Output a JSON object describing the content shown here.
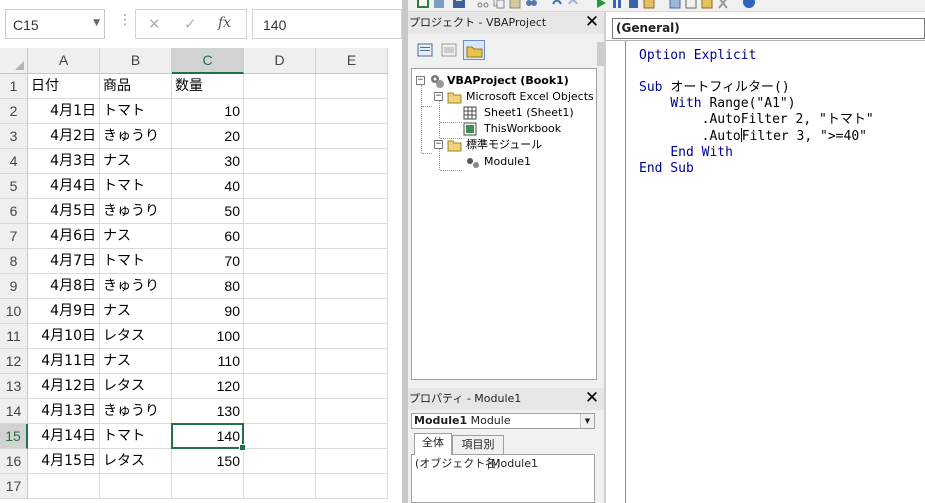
{
  "excel": {
    "name_box": "C15",
    "formula_value": "140",
    "formula_buttons": {
      "cancel": "✕",
      "enter": "✓",
      "fx": "fx"
    },
    "columns": [
      "A",
      "B",
      "C",
      "D",
      "E"
    ],
    "selected_column": "C",
    "selected_row": 15,
    "rows": [
      {
        "n": "1",
        "a": "日付",
        "b": "商品",
        "c": "数量"
      },
      {
        "n": "2",
        "a": "4月1日",
        "b": "トマト",
        "c": "10"
      },
      {
        "n": "3",
        "a": "4月2日",
        "b": "きゅうり",
        "c": "20"
      },
      {
        "n": "4",
        "a": "4月3日",
        "b": "ナス",
        "c": "30"
      },
      {
        "n": "5",
        "a": "4月4日",
        "b": "トマト",
        "c": "40"
      },
      {
        "n": "6",
        "a": "4月5日",
        "b": "きゅうり",
        "c": "50"
      },
      {
        "n": "7",
        "a": "4月6日",
        "b": "ナス",
        "c": "60"
      },
      {
        "n": "8",
        "a": "4月7日",
        "b": "トマト",
        "c": "70"
      },
      {
        "n": "9",
        "a": "4月8日",
        "b": "きゅうり",
        "c": "80"
      },
      {
        "n": "10",
        "a": "4月9日",
        "b": "ナス",
        "c": "90"
      },
      {
        "n": "11",
        "a": "4月10日",
        "b": "レタス",
        "c": "100"
      },
      {
        "n": "12",
        "a": "4月11日",
        "b": "ナス",
        "c": "110"
      },
      {
        "n": "13",
        "a": "4月12日",
        "b": "レタス",
        "c": "120"
      },
      {
        "n": "14",
        "a": "4月13日",
        "b": "きゅうり",
        "c": "130"
      },
      {
        "n": "15",
        "a": "4月14日",
        "b": "トマト",
        "c": "140"
      },
      {
        "n": "16",
        "a": "4月15日",
        "b": "レタス",
        "c": "150"
      },
      {
        "n": "17",
        "a": "",
        "b": "",
        "c": ""
      }
    ]
  },
  "project_panel": {
    "title": "プロジェクト - VBAProject",
    "close": "✕",
    "tree": {
      "project": "VBAProject (Book1)",
      "objects_folder": "Microsoft Excel Objects",
      "sheet": "Sheet1 (Sheet1)",
      "workbook": "ThisWorkbook",
      "modules_folder": "標準モジュール",
      "module": "Module1"
    }
  },
  "properties_panel": {
    "title": "プロパティ - Module1",
    "close": "✕",
    "object_name": "Module1",
    "object_type": "Module",
    "tabs": [
      "全体",
      "項目別"
    ],
    "property_name": "(オブジェクト名)",
    "property_value": "Module1"
  },
  "code_window": {
    "combo": "(General)",
    "lines": {
      "l1_kw": "Option Explicit",
      "l2_kw": "Sub ",
      "l2_name": "オートフィルター()",
      "l3_kw": "With ",
      "l3_txt": "Range(\"A1\")",
      "l4": ".AutoFilter 2, \"トマト\"",
      "l5a": ".Auto",
      "l5b": "Filter 3, \">=40\"",
      "l6": "End With",
      "l7": "End Sub"
    }
  },
  "colors": {
    "excel_green": "#217346",
    "vba_keyword": "#00008b"
  }
}
